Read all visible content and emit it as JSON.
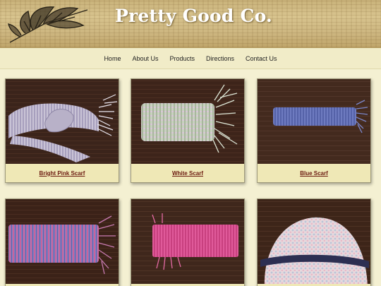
{
  "site": {
    "title": "Pretty Good Co."
  },
  "nav": {
    "items": [
      "Home",
      "About Us",
      "Products",
      "Directions",
      "Contact Us"
    ]
  },
  "products": [
    {
      "name": "Bright Pink Scarf"
    },
    {
      "name": "White Scarf"
    },
    {
      "name": "Blue Scarf"
    }
  ],
  "colors": {
    "page_background": "#f4f0d2",
    "nav_background": "#f1ecc8",
    "card_background": "#efe8b6",
    "product_link": "#6b1a10",
    "wood_table": "#3a2318"
  },
  "icons": [
    "leaf-logo-icon"
  ]
}
